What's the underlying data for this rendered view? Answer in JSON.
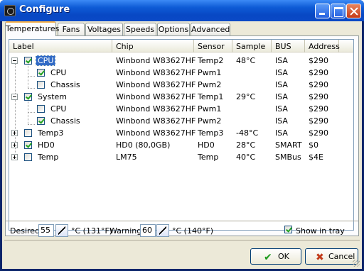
{
  "window": {
    "title": "Configure"
  },
  "tabs": [
    {
      "label": "Temperatures",
      "active": true
    },
    {
      "label": "Fans",
      "active": false
    },
    {
      "label": "Voltages",
      "active": false
    },
    {
      "label": "Speeds",
      "active": false
    },
    {
      "label": "Options",
      "active": false
    },
    {
      "label": "Advanced",
      "active": false
    }
  ],
  "columns": [
    "Label",
    "Chip",
    "Sensor",
    "Sample",
    "BUS",
    "Address"
  ],
  "rows": [
    {
      "label": "CPU",
      "chip": "Winbond W83627HF",
      "sensor": "Temp2",
      "sample": "48°C",
      "bus": "ISA",
      "address": "$290",
      "checked": true,
      "level": 0,
      "expander": "minus",
      "selected": true
    },
    {
      "label": "CPU",
      "chip": "Winbond W83627HF",
      "sensor": "Pwm1",
      "sample": "",
      "bus": "ISA",
      "address": "$290",
      "checked": true,
      "level": 1,
      "expander": "none"
    },
    {
      "label": "Chassis",
      "chip": "Winbond W83627HF",
      "sensor": "Pwm2",
      "sample": "",
      "bus": "ISA",
      "address": "$290",
      "checked": false,
      "level": 1,
      "expander": "none"
    },
    {
      "label": "System",
      "chip": "Winbond W83627HF",
      "sensor": "Temp1",
      "sample": "29°C",
      "bus": "ISA",
      "address": "$290",
      "checked": true,
      "level": 0,
      "expander": "minus"
    },
    {
      "label": "CPU",
      "chip": "Winbond W83627HF",
      "sensor": "Pwm1",
      "sample": "",
      "bus": "ISA",
      "address": "$290",
      "checked": false,
      "level": 1,
      "expander": "none"
    },
    {
      "label": "Chassis",
      "chip": "Winbond W83627HF",
      "sensor": "Pwm2",
      "sample": "",
      "bus": "ISA",
      "address": "$290",
      "checked": true,
      "level": 1,
      "expander": "none"
    },
    {
      "label": "Temp3",
      "chip": "Winbond W83627HF",
      "sensor": "Temp3",
      "sample": "-48°C",
      "bus": "ISA",
      "address": "$290",
      "checked": false,
      "level": 0,
      "expander": "plus"
    },
    {
      "label": "HD0",
      "chip": "HD0 (80,0GB)",
      "sensor": "HD0",
      "sample": "28°C",
      "bus": "SMART",
      "address": "$0",
      "checked": true,
      "level": 0,
      "expander": "plus"
    },
    {
      "label": "Temp",
      "chip": "LM75",
      "sensor": "Temp",
      "sample": "40°C",
      "bus": "SMBus",
      "address": "$4E",
      "checked": false,
      "level": 0,
      "expander": "plus"
    }
  ],
  "bottom": {
    "desired_label": "Desired",
    "desired_value": "55",
    "desired_unit": "°C (131°F)",
    "warning_label": "Warning",
    "warning_value": "60",
    "warning_unit": "°C (140°F)",
    "show_in_tray_label": "Show in tray",
    "show_in_tray_checked": true
  },
  "buttons": {
    "ok": "OK",
    "cancel": "Cancel"
  },
  "icons": {
    "title": "sensor-app-icon",
    "ok": "check-icon",
    "cancel": "x-icon"
  },
  "colors": {
    "title_bar": "#0a49c6",
    "selection": "#316ac5",
    "tab_highlight": "#f3b04c",
    "dialog_bg": "#ece9d8"
  }
}
